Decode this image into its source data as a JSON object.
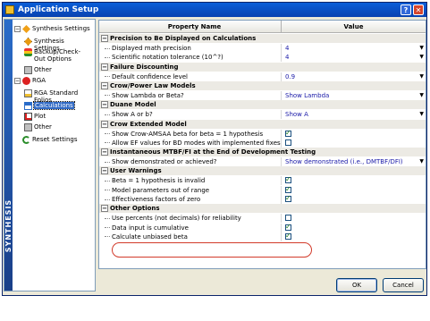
{
  "window": {
    "title": "Application Setup",
    "help_btn": "?",
    "close_btn": "✕"
  },
  "brand": {
    "vertical_text": "SYNTHESIS"
  },
  "tree": [
    {
      "label": "Synthesis Settings",
      "level": 0,
      "expander": "−",
      "icon": "synthesis-icon"
    },
    {
      "label": "Synthesis Settings",
      "level": 1,
      "icon": "synthesis-settings-icon"
    },
    {
      "label": "Backup/Check-Out Options",
      "level": 1,
      "icon": "backup-icon"
    },
    {
      "label": "Other",
      "level": 1,
      "icon": "other-icon"
    },
    {
      "label": "RGA",
      "level": 0,
      "expander": "−",
      "icon": "rga-icon"
    },
    {
      "label": "RGA Standard Folios",
      "level": 1,
      "icon": "rga-standard-folios-icon"
    },
    {
      "label": "Calculations",
      "level": 1,
      "icon": "calculations-icon",
      "selected": true
    },
    {
      "label": "Plot",
      "level": 1,
      "icon": "plot-icon"
    },
    {
      "label": "Other",
      "level": 1,
      "icon": "other-icon"
    },
    {
      "label": "Reset Settings",
      "level": 0,
      "icon": "reset-icon"
    }
  ],
  "grid": {
    "headers": {
      "property": "Property Name",
      "value": "Value"
    },
    "rows": [
      {
        "type": "category",
        "label": "Precision to Be Displayed on Calculations"
      },
      {
        "type": "prop",
        "label": "Displayed math precision",
        "value": "4",
        "dropdown": true
      },
      {
        "type": "prop",
        "label": "Scientific notation tolerance (10^?)",
        "value": "4",
        "dropdown": true
      },
      {
        "type": "category",
        "label": "Failure Discounting"
      },
      {
        "type": "prop",
        "label": "Default confidence level",
        "value": "0.9",
        "dropdown": true
      },
      {
        "type": "category",
        "label": "Crow/Power Law Models"
      },
      {
        "type": "prop",
        "label": "Show Lambda or Beta?",
        "value": "Show Lambda",
        "dropdown": true
      },
      {
        "type": "category",
        "label": "Duane Model"
      },
      {
        "type": "prop",
        "label": "Show A or b?",
        "value": "Show A",
        "dropdown": true
      },
      {
        "type": "category",
        "label": "Crow Extended Model"
      },
      {
        "type": "prop",
        "label": "Show Crow-AMSAA beta for beta = 1 hypothesis",
        "checked": true
      },
      {
        "type": "prop",
        "label": "Allow EF values for BD modes with implemented fixes",
        "checked": false
      },
      {
        "type": "category",
        "label": "Instantaneous MTBF/FI at the End of Development Testing"
      },
      {
        "type": "prop",
        "label": "Show demonstrated or achieved?",
        "value": "Show demonstrated (i.e., DMTBF/DFI)",
        "dropdown": true
      },
      {
        "type": "category",
        "label": "User Warnings"
      },
      {
        "type": "prop",
        "label": "Beta = 1 hypothesis is invalid",
        "checked": true
      },
      {
        "type": "prop",
        "label": "Model parameters out of range",
        "checked": true
      },
      {
        "type": "prop",
        "label": "Effectiveness factors of zero",
        "checked": true
      },
      {
        "type": "category",
        "label": "Other Options"
      },
      {
        "type": "prop",
        "label": "Use percents (not decimals) for reliability",
        "checked": false
      },
      {
        "type": "prop",
        "label": "Data input is cumulative",
        "checked": true
      },
      {
        "type": "prop",
        "label": "Calculate unbiased beta",
        "checked": true
      }
    ]
  },
  "buttons": {
    "ok": "OK",
    "cancel": "Cancel"
  },
  "colors": {
    "title_bar": "#0a5ed8",
    "highlight_ellipse": "#d23a2a",
    "value_text": "#1a1aa8"
  }
}
